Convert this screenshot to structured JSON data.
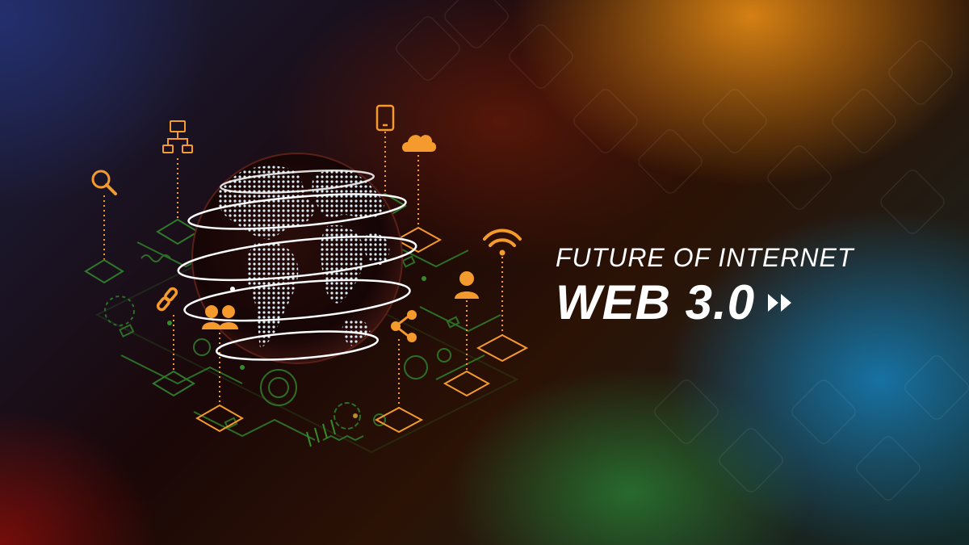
{
  "banner": {
    "subtitle": "FUTURE OF INTERNET",
    "title": "WEB 3.0"
  },
  "icons": [
    "magnifier-icon",
    "network-icon",
    "link-icon",
    "users-icon",
    "tablet-icon",
    "cloud-icon",
    "wifi-icon",
    "user-icon",
    "share-icon",
    "fast-forward-icon",
    "globe-icon"
  ],
  "colors": {
    "accent": "#f59a2c",
    "circuit": "#2f7a2a",
    "globe": "#cfe6f5",
    "text": "#ffffff"
  }
}
